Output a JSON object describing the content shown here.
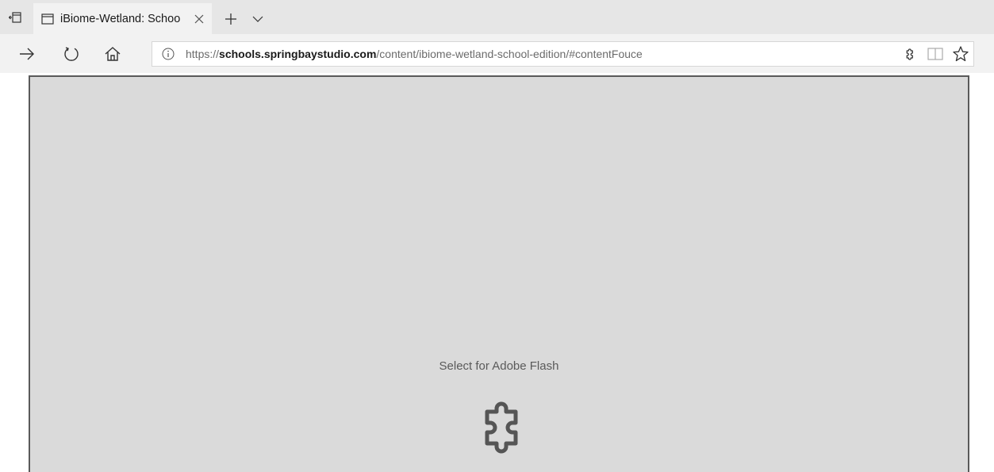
{
  "browser": {
    "tab": {
      "title": "iBiome-Wetland: Schoo"
    },
    "address": {
      "url_prefix": "https://",
      "url_host": "schools.springbaystudio.com",
      "url_path": "/content/ibiome-wetland-school-edition/#contentFouce"
    }
  },
  "content": {
    "flash_prompt": "Select for Adobe Flash"
  },
  "colors": {
    "tabbar_bg": "#e6e6e6",
    "navbar_bg": "#f2f2f2",
    "flash_bg": "#dadada",
    "icon": "#333333"
  },
  "icons": {
    "tab_switch": "set-aside-tabs-icon",
    "tab_page": "page-icon",
    "tab_close": "close-icon",
    "new_tab": "plus-icon",
    "tab_list": "chevron-down-icon",
    "forward": "forward-arrow-icon",
    "refresh": "refresh-icon",
    "home": "home-icon",
    "site_info": "info-icon",
    "extension": "puzzle-icon",
    "reading_view": "book-icon",
    "favorite": "star-icon",
    "flash_plugin": "puzzle-icon"
  }
}
